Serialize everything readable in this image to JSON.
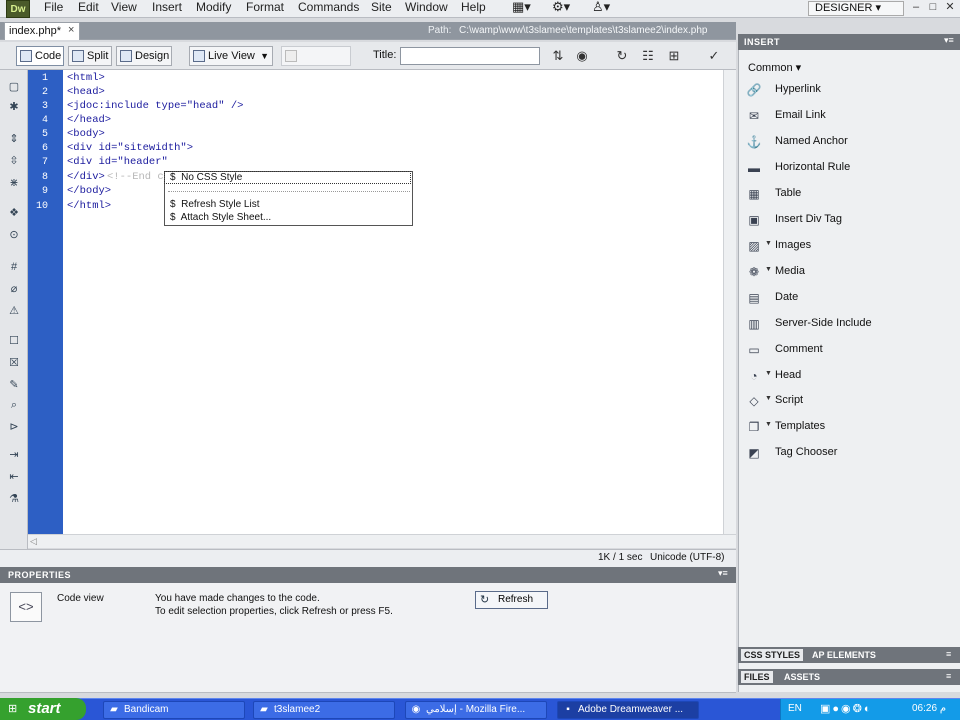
{
  "app": {
    "logo_text": "Dw",
    "menu": [
      "File",
      "Edit",
      "View",
      "Insert",
      "Modify",
      "Format",
      "Commands",
      "Site",
      "Window",
      "Help"
    ],
    "workspace": "DESIGNER ▾",
    "window_controls": [
      "–",
      "□",
      "✕"
    ]
  },
  "document": {
    "tab": "index.php*",
    "tab_close": "×",
    "path_label": "Path:",
    "path_value": "C:\\wamp\\www\\t3slamee\\templates\\t3slamee2\\index.php"
  },
  "toolbar": {
    "code_label": "Code",
    "split_label": "Split",
    "design_label": "Design",
    "live_view_label": "Live View",
    "title_label": "Title:",
    "title_value": ""
  },
  "code": {
    "line_numbers": [
      "1",
      "2",
      "3",
      "4",
      "5",
      "6",
      "7",
      "8",
      "9",
      "10"
    ],
    "lines": [
      "<html>",
      "<head>",
      "<jdoc:include type=\"head\" />",
      "</head>",
      "<body>",
      "<div id=\"sitewidth\">",
      "<div id=\"header\"",
      "</div>",
      "</body>",
      "</html>"
    ],
    "line8_comment": "<!--End c"
  },
  "popup": {
    "items": [
      {
        "label": "No CSS Style",
        "icon": "$"
      },
      {
        "label": "Refresh Style List",
        "icon": "$"
      },
      {
        "label": "Attach Style Sheet...",
        "icon": "$"
      }
    ]
  },
  "status": {
    "size": "1K / 1 sec",
    "encoding": "Unicode (UTF-8)"
  },
  "properties": {
    "title": "PROPERTIES",
    "menu_glyph": "▾≡",
    "mode_label": "Code view",
    "message_line1": "You have made changes to the code.",
    "message_line2": "To edit selection properties, click Refresh or press F5.",
    "refresh_label": "Refresh"
  },
  "insert_panel": {
    "title": "INSERT",
    "menu_glyph": "▾≡",
    "category": "Common ▾",
    "items": [
      {
        "label": "Hyperlink",
        "icon": "link-icon",
        "submenu": false
      },
      {
        "label": "Email Link",
        "icon": "email-icon",
        "submenu": false
      },
      {
        "label": "Named Anchor",
        "icon": "anchor-icon",
        "submenu": false
      },
      {
        "label": "Horizontal Rule",
        "icon": "rule-icon",
        "submenu": false
      },
      {
        "label": "Table",
        "icon": "table-icon",
        "submenu": false
      },
      {
        "label": "Insert Div Tag",
        "icon": "div-tag-icon",
        "submenu": false
      },
      {
        "label": "Images",
        "icon": "image-icon",
        "submenu": true
      },
      {
        "label": "Media",
        "icon": "media-icon",
        "submenu": true
      },
      {
        "label": "Date",
        "icon": "calendar-icon",
        "submenu": false
      },
      {
        "label": "Server-Side Include",
        "icon": "ssi-icon",
        "submenu": false
      },
      {
        "label": "Comment",
        "icon": "comment-icon",
        "submenu": false
      },
      {
        "label": "Head",
        "icon": "head-icon",
        "submenu": true
      },
      {
        "label": "Script",
        "icon": "script-icon",
        "submenu": true
      },
      {
        "label": "Templates",
        "icon": "template-icon",
        "submenu": true
      },
      {
        "label": "Tag Chooser",
        "icon": "tag-chooser-icon",
        "submenu": false
      }
    ],
    "css_tabs": [
      "CSS STYLES",
      "AP ELEMENTS"
    ],
    "file_tabs": [
      "FILES",
      "ASSETS"
    ]
  },
  "taskbar": {
    "start_label": "start",
    "tasks": [
      {
        "label": "Bandicam",
        "active": false
      },
      {
        "label": "t3slamee2",
        "active": false
      },
      {
        "label": "إسلامي - Mozilla Fire...",
        "active": false
      },
      {
        "label": "Adobe Dreamweaver ...",
        "active": true
      }
    ],
    "language": "EN",
    "tray_icons": "▣●◉❂◐",
    "clock": "06:26 م"
  },
  "colors": {
    "gutter": "#2d5fc4",
    "code_text": "#1b1b9e",
    "panel_header": "#6f747b",
    "taskbar": "#2a56d6",
    "start_button": "#35a12e"
  }
}
